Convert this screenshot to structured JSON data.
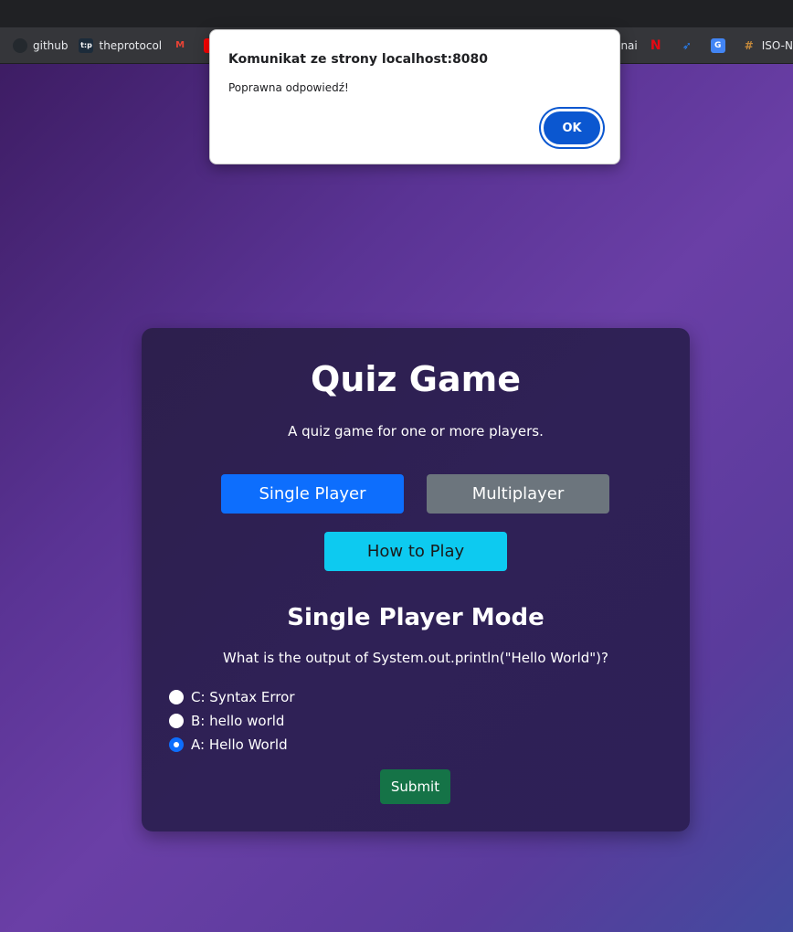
{
  "browser": {
    "bookmarks": [
      {
        "label": "github",
        "icon": "github-icon",
        "color": "#e8eaed"
      },
      {
        "label": "theprotocol",
        "icon": "theprotocol-icon",
        "color": "#1a73e8"
      },
      {
        "label": "",
        "icon": "gmail-icon",
        "color": "#ea4335"
      },
      {
        "label": "",
        "icon": "youtube-icon",
        "color": "#ff0000"
      }
    ],
    "bookmarks_right": [
      {
        "label": "openai",
        "icon": "openai-icon",
        "color": "#e8eaed"
      },
      {
        "label": "",
        "icon": "netflix-icon",
        "color": "#e50914"
      },
      {
        "label": "",
        "icon": "jira-icon",
        "color": "#2684ff"
      },
      {
        "label": "",
        "icon": "translate-icon",
        "color": "#4285f4"
      },
      {
        "label": "ISO-N",
        "icon": "iso-icon",
        "color": "#c58a3b"
      }
    ]
  },
  "dialog": {
    "title": "Komunikat ze strony localhost:8080",
    "message": "Poprawna odpowiedź!",
    "ok_label": "OK"
  },
  "quiz": {
    "title": "Quiz Game",
    "subtitle": "A quiz game for one or more players.",
    "buttons": {
      "single": "Single Player",
      "multi": "Multiplayer",
      "how": "How to Play"
    },
    "mode_title": "Single Player Mode",
    "question": "What is the output of System.out.println(\"Hello World\")?",
    "options": [
      {
        "label": "C: Syntax Error",
        "checked": false
      },
      {
        "label": "B: hello world",
        "checked": false
      },
      {
        "label": "A: Hello World",
        "checked": true
      }
    ],
    "submit_label": "Submit"
  }
}
